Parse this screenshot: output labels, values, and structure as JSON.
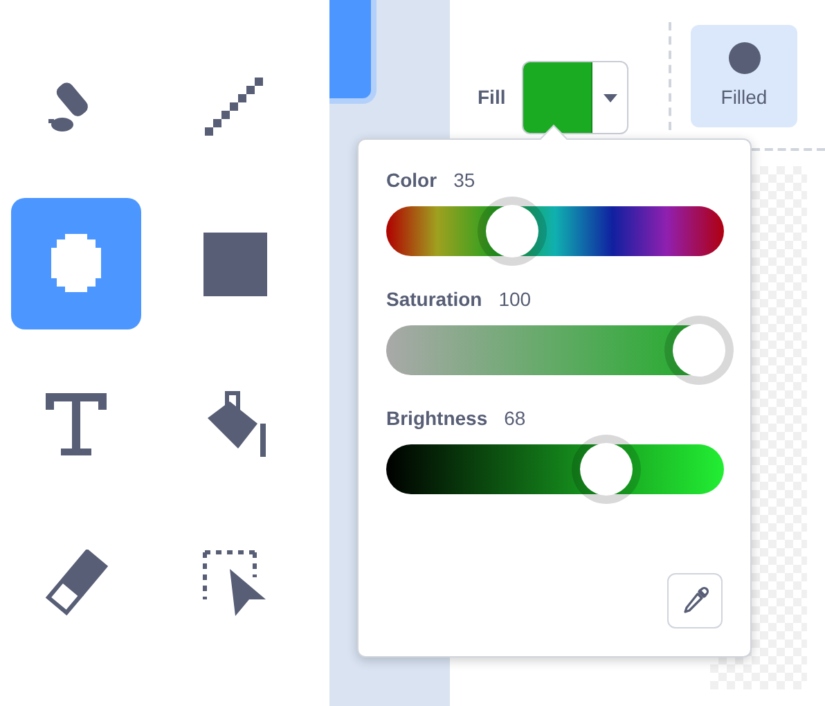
{
  "tools": [
    {
      "kind": "brush",
      "selected": false
    },
    {
      "kind": "line",
      "selected": false
    },
    {
      "kind": "circle",
      "selected": true
    },
    {
      "kind": "rectangle",
      "selected": false
    },
    {
      "kind": "text",
      "selected": false
    },
    {
      "kind": "fill",
      "selected": false
    },
    {
      "kind": "eraser",
      "selected": false
    },
    {
      "kind": "select",
      "selected": false
    }
  ],
  "fill": {
    "label": "Fill",
    "color": "#1aab23"
  },
  "mode_button": {
    "label": "Filled",
    "selected": true
  },
  "sliders": [
    {
      "kind": "hue",
      "label": "Color",
      "value": "35",
      "level": 0.35
    },
    {
      "kind": "saturation",
      "label": "Saturation",
      "value": "100",
      "level": 1
    },
    {
      "kind": "brightness",
      "label": "Brightness",
      "value": "68",
      "level": 0.68
    }
  ]
}
